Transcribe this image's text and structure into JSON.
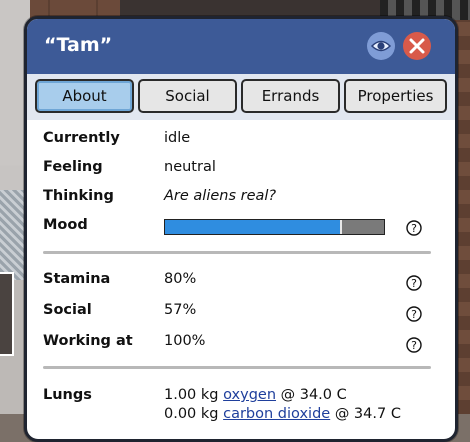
{
  "window": {
    "title": "“Tam”",
    "tabs": [
      {
        "label": "About",
        "active": true
      },
      {
        "label": "Social",
        "active": false
      },
      {
        "label": "Errands",
        "active": false
      },
      {
        "label": "Properties",
        "active": false
      }
    ]
  },
  "about": {
    "currently": {
      "label": "Currently",
      "value": "idle"
    },
    "feeling": {
      "label": "Feeling",
      "value": "neutral"
    },
    "thinking": {
      "label": "Thinking",
      "value": "Are aliens real?"
    },
    "mood": {
      "label": "Mood",
      "level_fraction": 0.81
    }
  },
  "stats": {
    "stamina": {
      "label": "Stamina",
      "value": "80%"
    },
    "social": {
      "label": "Social",
      "value": "57%"
    },
    "working_at": {
      "label": "Working at",
      "value": "100%"
    }
  },
  "lungs": {
    "label": "Lungs",
    "line1": {
      "amount": "1.00 kg",
      "gas": "oxygen",
      "temp": "@ 34.0 C"
    },
    "line2": {
      "amount": "0.00 kg",
      "gas": "carbon dioxide",
      "temp": "@ 34.7 C"
    }
  },
  "icons": {
    "eye": "eye-icon",
    "close": "close-icon",
    "help": "question-circle-icon"
  },
  "colors": {
    "titlebar": "#3d5a97",
    "active_tab": "#a8cdec",
    "mood_fill": "#2f8de0",
    "close": "#d85a4a"
  }
}
